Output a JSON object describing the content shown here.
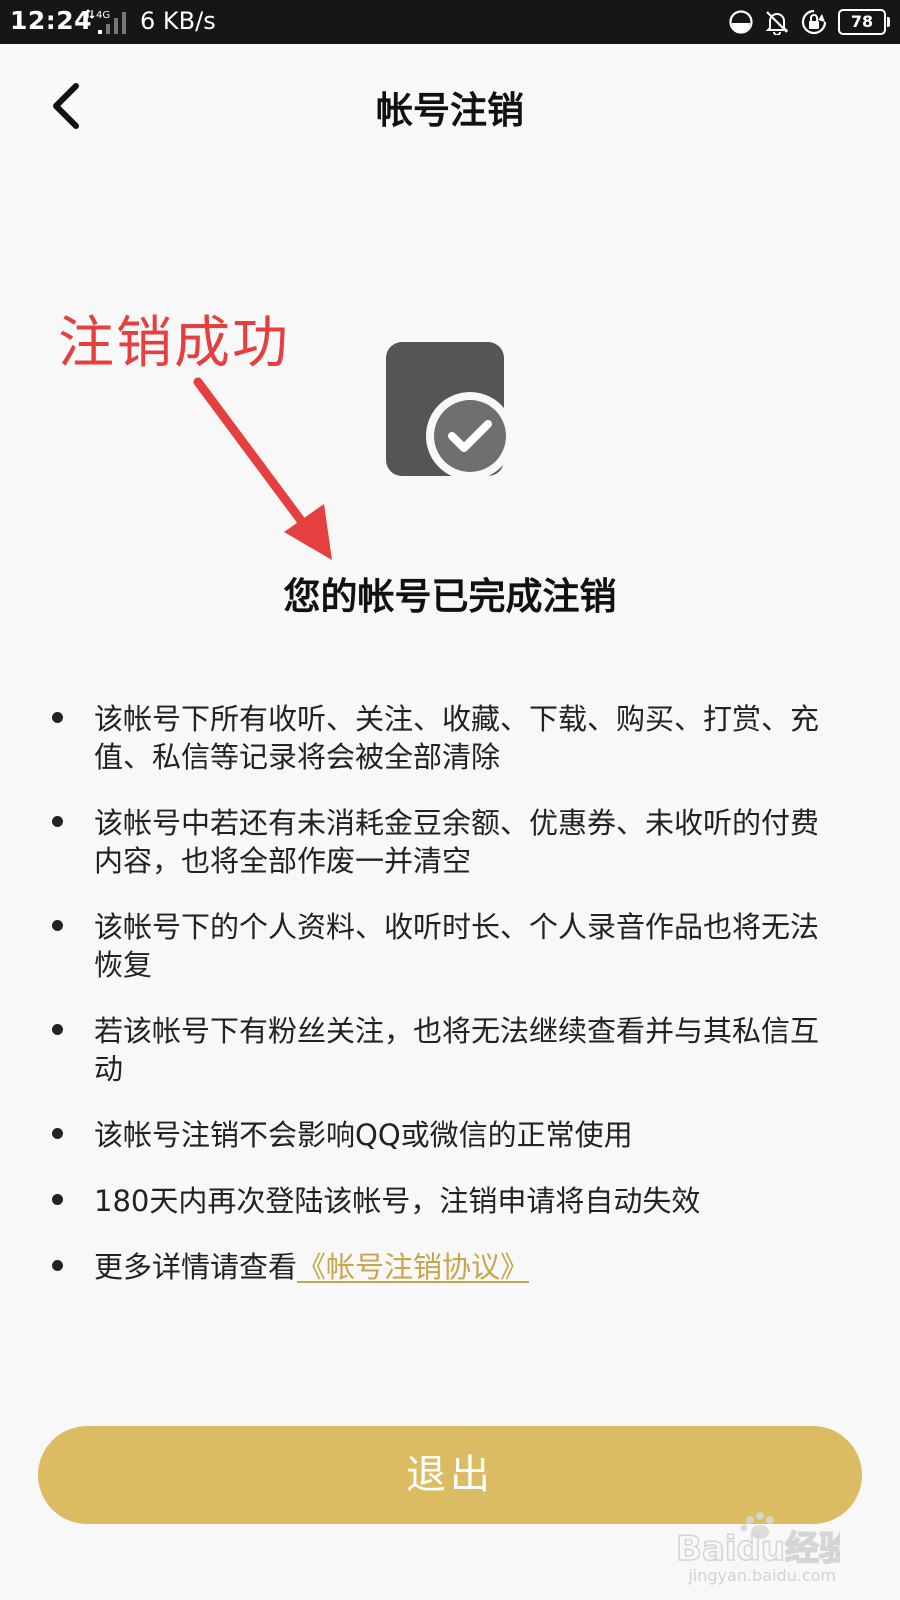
{
  "status_bar": {
    "time": "12:24",
    "network": "4G",
    "speed": "6 KB/s",
    "battery": "78",
    "icons": [
      "data-saver-icon",
      "bell-muted-icon",
      "rotation-lock-icon",
      "battery-icon"
    ]
  },
  "header": {
    "title": "帐号注销",
    "back_icon": "chevron-left-icon"
  },
  "annotation": {
    "text": "注销成功",
    "color": "#e53f3f"
  },
  "result": {
    "icon": "document-check-icon",
    "title": "您的帐号已完成注销"
  },
  "notices": [
    {
      "text": "该帐号下所有收听、关注、收藏、下载、购买、打赏、充值、私信等记录将会被全部清除"
    },
    {
      "text": "该帐号中若还有未消耗金豆余额、优惠券、未收听的付费内容，也将全部作废一并清空"
    },
    {
      "text": "该帐号下的个人资料、收听时长、个人录音作品也将无法恢复"
    },
    {
      "text": "若该帐号下有粉丝关注，也将无法继续查看并与其私信互动"
    },
    {
      "text": "该帐号注销不会影响QQ或微信的正常使用"
    },
    {
      "text": "180天内再次登陆该帐号，注销申请将自动失效"
    },
    {
      "text": "更多详情请查看",
      "link": "《帐号注销协议》"
    }
  ],
  "exit_button": {
    "label": "退出",
    "color": "#dcbc63"
  },
  "watermark": {
    "brand": "Baidu经验",
    "url": "jingyan.baidu.com"
  }
}
